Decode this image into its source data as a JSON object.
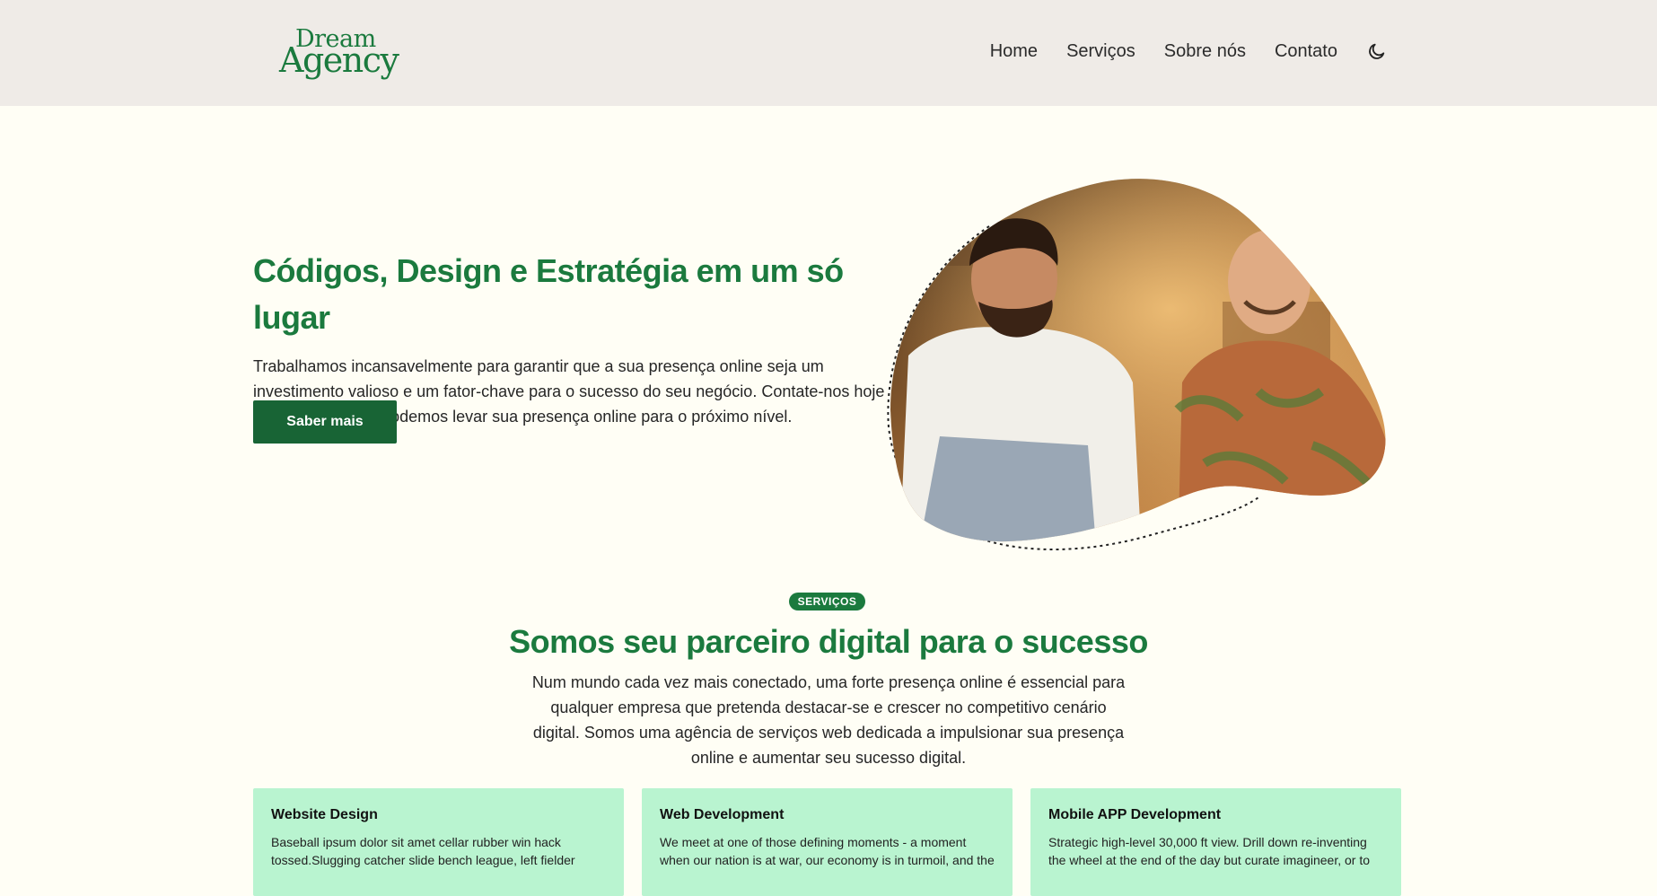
{
  "header": {
    "logo_line1": "Dream",
    "logo_line2": "Agency",
    "nav": [
      {
        "label": "Home"
      },
      {
        "label": "Serviços"
      },
      {
        "label": "Sobre nós"
      },
      {
        "label": "Contato"
      }
    ],
    "theme_toggle_icon": "moon-icon"
  },
  "hero": {
    "title": "Códigos, Design e Estratégia em um só lugar",
    "description": "Trabalhamos incansavelmente para garantir que a sua presença online seja um investimento valioso e um fator-chave para o sucesso do seu negócio. Contate-nos hoje e descubra como podemos levar sua presença online para o próximo nível.",
    "cta_label": "Saber mais",
    "image_icon": "team-photo"
  },
  "services": {
    "badge": "SERVIÇOS",
    "title": "Somos seu parceiro digital para o sucesso",
    "description": "Num mundo cada vez mais conectado, uma forte presença online é essencial para qualquer empresa que pretenda destacar-se e crescer no competitivo cenário digital. Somos uma agência de serviços web dedicada a impulsionar sua presença online e aumentar seu sucesso digital.",
    "cards": [
      {
        "title": "Website Design",
        "text": "Baseball ipsum dolor sit amet cellar rubber win hack tossed.Slugging catcher slide bench league, left fielder"
      },
      {
        "title": "Web Development",
        "text": "We meet at one of those defining moments - a moment when our nation is at war, our economy is in turmoil, and the"
      },
      {
        "title": "Mobile APP Development",
        "text": "Strategic high-level 30,000 ft view. Drill down re-inventing the wheel at the end of the day but curate imagineer, or to"
      }
    ]
  },
  "colors": {
    "brand_green": "#1b7a3e",
    "button_green": "#186435",
    "card_bg": "#b9f4d0",
    "header_bg": "#efebe7",
    "page_bg": "#fffef5"
  }
}
